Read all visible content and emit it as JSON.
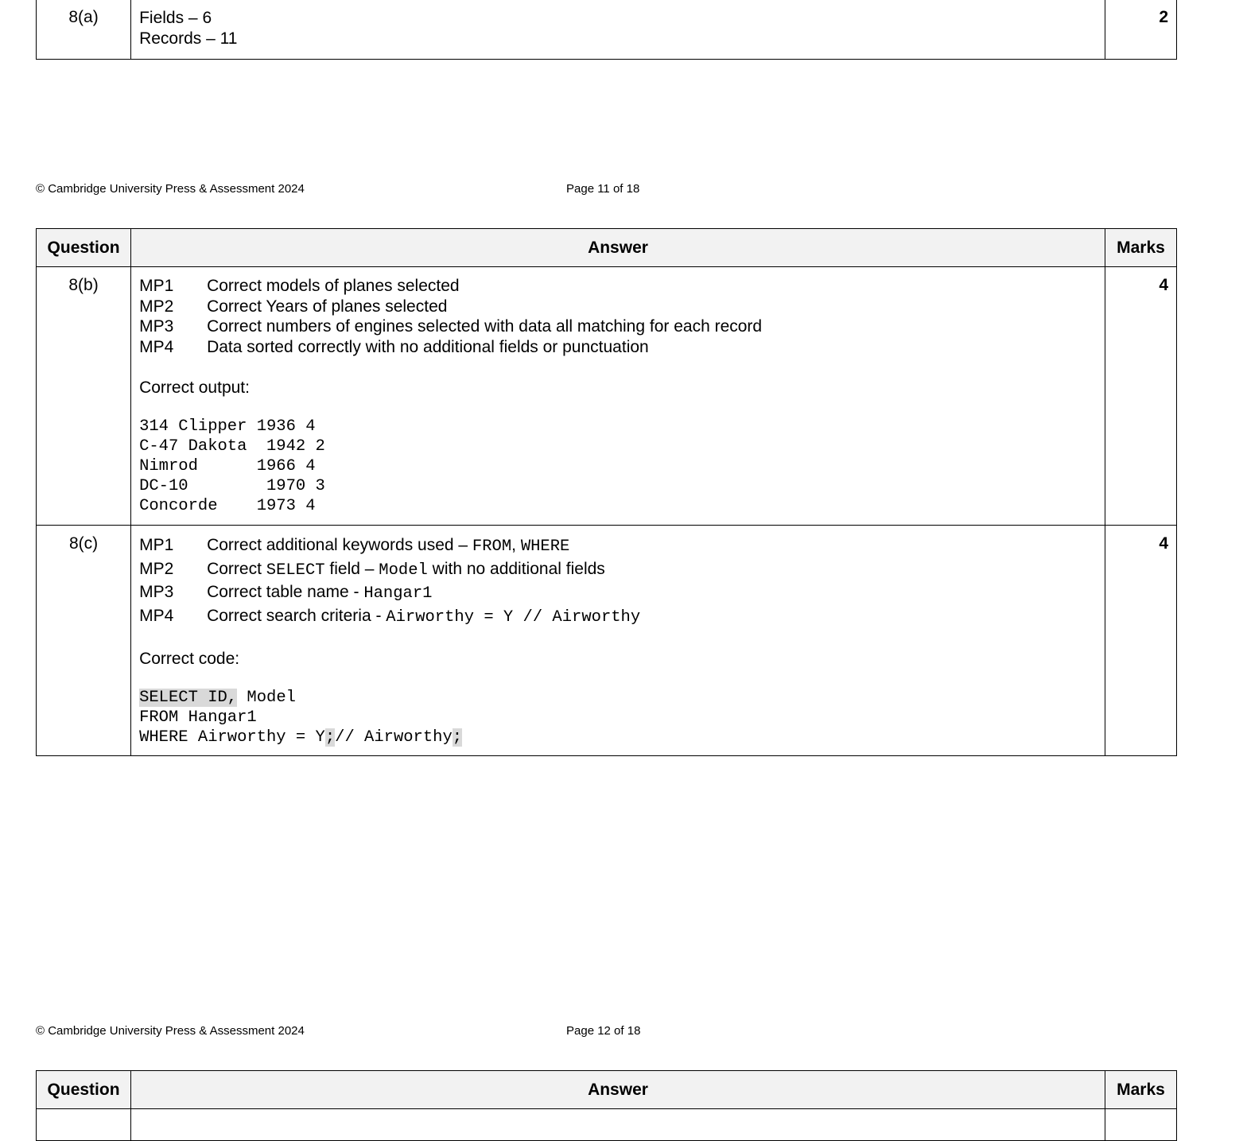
{
  "q8a": {
    "question": "8(a)",
    "answer_lines": [
      "Fields – 6",
      "Records – 11"
    ],
    "marks": "2"
  },
  "footer1": {
    "copyright": "© Cambridge University Press & Assessment 2024",
    "page": "Page 11 of 18"
  },
  "table_headers": {
    "question": "Question",
    "answer": "Answer",
    "marks": "Marks"
  },
  "q8b": {
    "question": "8(b)",
    "marks": "4",
    "mark_points": [
      {
        "code": "MP1",
        "text": "Correct models of planes selected"
      },
      {
        "code": "MP2",
        "text": "Correct Years of planes selected"
      },
      {
        "code": "MP3",
        "text": "Correct numbers of engines selected with data all matching for each record"
      },
      {
        "code": "MP4",
        "text": "Data sorted correctly with no additional fields or punctuation"
      }
    ],
    "output_label": "Correct output:",
    "output_lines": [
      "314 Clipper 1936 4",
      "C-47 Dakota  1942 2",
      "Nimrod      1966 4",
      "DC-10        1970 3",
      "Concorde    1973 4"
    ]
  },
  "q8c": {
    "question": "8(c)",
    "marks": "4",
    "mp1": {
      "code": "MP1",
      "text": "Correct additional keywords used – ",
      "kw1": "FROM",
      "sep": ", ",
      "kw2": "WHERE"
    },
    "mp2": {
      "code": "MP2",
      "pre": "Correct ",
      "kw1": "SELECT",
      "mid": " field – ",
      "kw2": "Model",
      "post": " with no additional fields"
    },
    "mp3": {
      "code": "MP3",
      "pre": "Correct table name - ",
      "kw": "Hangar1"
    },
    "mp4": {
      "code": "MP4",
      "pre": "Correct search criteria - ",
      "kw": "Airworthy = Y // Airworthy"
    },
    "code_label": "Correct code:",
    "code": {
      "l1_hl": "SELECT ID,",
      "l1_rest": " Model",
      "l2": "FROM Hangar1",
      "l3_pre": "WHERE Airworthy = Y",
      "l3_semi1": ";",
      "l3_mid": "// Airworthy",
      "l3_semi2": ";"
    }
  },
  "footer2": {
    "copyright": "© Cambridge University Press & Assessment 2024",
    "page": "Page 12 of 18"
  }
}
